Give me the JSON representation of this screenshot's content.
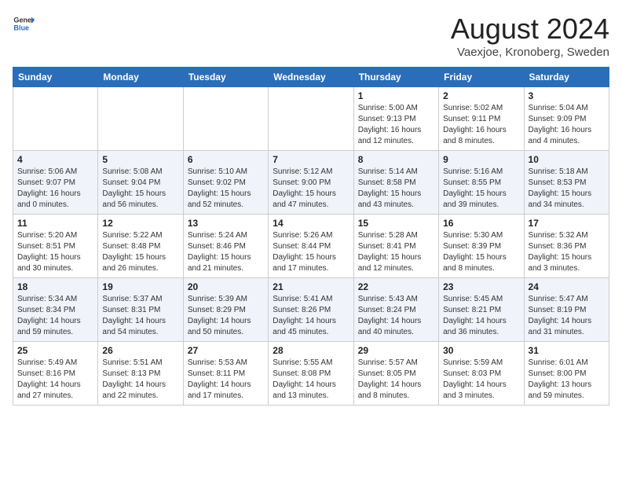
{
  "header": {
    "logo_general": "General",
    "logo_blue": "Blue",
    "title": "August 2024",
    "subtitle": "Vaexjoe, Kronoberg, Sweden"
  },
  "weekdays": [
    "Sunday",
    "Monday",
    "Tuesday",
    "Wednesday",
    "Thursday",
    "Friday",
    "Saturday"
  ],
  "weeks": [
    [
      {
        "num": "",
        "info": ""
      },
      {
        "num": "",
        "info": ""
      },
      {
        "num": "",
        "info": ""
      },
      {
        "num": "",
        "info": ""
      },
      {
        "num": "1",
        "info": "Sunrise: 5:00 AM\nSunset: 9:13 PM\nDaylight: 16 hours\nand 12 minutes."
      },
      {
        "num": "2",
        "info": "Sunrise: 5:02 AM\nSunset: 9:11 PM\nDaylight: 16 hours\nand 8 minutes."
      },
      {
        "num": "3",
        "info": "Sunrise: 5:04 AM\nSunset: 9:09 PM\nDaylight: 16 hours\nand 4 minutes."
      }
    ],
    [
      {
        "num": "4",
        "info": "Sunrise: 5:06 AM\nSunset: 9:07 PM\nDaylight: 16 hours\nand 0 minutes."
      },
      {
        "num": "5",
        "info": "Sunrise: 5:08 AM\nSunset: 9:04 PM\nDaylight: 15 hours\nand 56 minutes."
      },
      {
        "num": "6",
        "info": "Sunrise: 5:10 AM\nSunset: 9:02 PM\nDaylight: 15 hours\nand 52 minutes."
      },
      {
        "num": "7",
        "info": "Sunrise: 5:12 AM\nSunset: 9:00 PM\nDaylight: 15 hours\nand 47 minutes."
      },
      {
        "num": "8",
        "info": "Sunrise: 5:14 AM\nSunset: 8:58 PM\nDaylight: 15 hours\nand 43 minutes."
      },
      {
        "num": "9",
        "info": "Sunrise: 5:16 AM\nSunset: 8:55 PM\nDaylight: 15 hours\nand 39 minutes."
      },
      {
        "num": "10",
        "info": "Sunrise: 5:18 AM\nSunset: 8:53 PM\nDaylight: 15 hours\nand 34 minutes."
      }
    ],
    [
      {
        "num": "11",
        "info": "Sunrise: 5:20 AM\nSunset: 8:51 PM\nDaylight: 15 hours\nand 30 minutes."
      },
      {
        "num": "12",
        "info": "Sunrise: 5:22 AM\nSunset: 8:48 PM\nDaylight: 15 hours\nand 26 minutes."
      },
      {
        "num": "13",
        "info": "Sunrise: 5:24 AM\nSunset: 8:46 PM\nDaylight: 15 hours\nand 21 minutes."
      },
      {
        "num": "14",
        "info": "Sunrise: 5:26 AM\nSunset: 8:44 PM\nDaylight: 15 hours\nand 17 minutes."
      },
      {
        "num": "15",
        "info": "Sunrise: 5:28 AM\nSunset: 8:41 PM\nDaylight: 15 hours\nand 12 minutes."
      },
      {
        "num": "16",
        "info": "Sunrise: 5:30 AM\nSunset: 8:39 PM\nDaylight: 15 hours\nand 8 minutes."
      },
      {
        "num": "17",
        "info": "Sunrise: 5:32 AM\nSunset: 8:36 PM\nDaylight: 15 hours\nand 3 minutes."
      }
    ],
    [
      {
        "num": "18",
        "info": "Sunrise: 5:34 AM\nSunset: 8:34 PM\nDaylight: 14 hours\nand 59 minutes."
      },
      {
        "num": "19",
        "info": "Sunrise: 5:37 AM\nSunset: 8:31 PM\nDaylight: 14 hours\nand 54 minutes."
      },
      {
        "num": "20",
        "info": "Sunrise: 5:39 AM\nSunset: 8:29 PM\nDaylight: 14 hours\nand 50 minutes."
      },
      {
        "num": "21",
        "info": "Sunrise: 5:41 AM\nSunset: 8:26 PM\nDaylight: 14 hours\nand 45 minutes."
      },
      {
        "num": "22",
        "info": "Sunrise: 5:43 AM\nSunset: 8:24 PM\nDaylight: 14 hours\nand 40 minutes."
      },
      {
        "num": "23",
        "info": "Sunrise: 5:45 AM\nSunset: 8:21 PM\nDaylight: 14 hours\nand 36 minutes."
      },
      {
        "num": "24",
        "info": "Sunrise: 5:47 AM\nSunset: 8:19 PM\nDaylight: 14 hours\nand 31 minutes."
      }
    ],
    [
      {
        "num": "25",
        "info": "Sunrise: 5:49 AM\nSunset: 8:16 PM\nDaylight: 14 hours\nand 27 minutes."
      },
      {
        "num": "26",
        "info": "Sunrise: 5:51 AM\nSunset: 8:13 PM\nDaylight: 14 hours\nand 22 minutes."
      },
      {
        "num": "27",
        "info": "Sunrise: 5:53 AM\nSunset: 8:11 PM\nDaylight: 14 hours\nand 17 minutes."
      },
      {
        "num": "28",
        "info": "Sunrise: 5:55 AM\nSunset: 8:08 PM\nDaylight: 14 hours\nand 13 minutes."
      },
      {
        "num": "29",
        "info": "Sunrise: 5:57 AM\nSunset: 8:05 PM\nDaylight: 14 hours\nand 8 minutes."
      },
      {
        "num": "30",
        "info": "Sunrise: 5:59 AM\nSunset: 8:03 PM\nDaylight: 14 hours\nand 3 minutes."
      },
      {
        "num": "31",
        "info": "Sunrise: 6:01 AM\nSunset: 8:00 PM\nDaylight: 13 hours\nand 59 minutes."
      }
    ]
  ]
}
